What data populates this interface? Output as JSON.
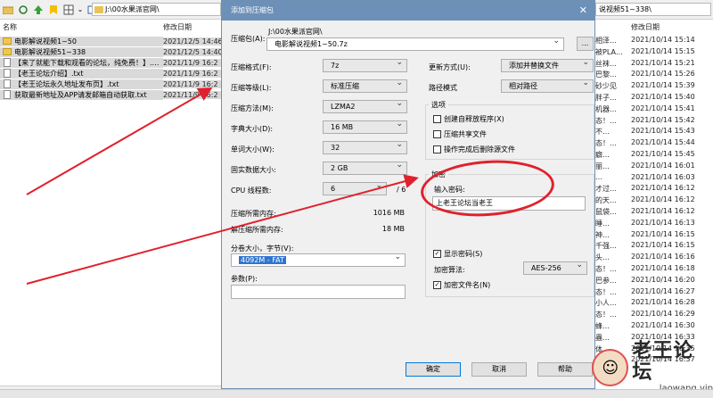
{
  "explorer_left": {
    "path": "J:\\00水果派官网\\",
    "columns": [
      "名称",
      "修改日期"
    ],
    "rows": [
      {
        "icon": "folder-icon",
        "name": "电影解说视频1~50",
        "date": "2021/12/5 14:46",
        "selected": true
      },
      {
        "icon": "folder-icon",
        "name": "电影解说视频51~338",
        "date": "2021/12/5 14:40",
        "selected": true
      },
      {
        "icon": "text-file-icon",
        "name": "【来了就能下载和观看的论坛，纯免费！】.…",
        "date": "2021/11/9 16:2",
        "selected": true
      },
      {
        "icon": "text-file-icon",
        "name": "【老王论坛介绍】.txt",
        "date": "2021/11/9 16:2",
        "selected": true
      },
      {
        "icon": "text-file-icon",
        "name": "【老王论坛永久地址发布页】.txt",
        "date": "2021/11/9 16:2",
        "selected": true
      },
      {
        "icon": "text-file-icon",
        "name": "获取最新地址及APP请发邮箱自动获取.txt",
        "date": "2021/11/9 16:2",
        "selected": true
      }
    ]
  },
  "explorer_right": {
    "path": "说视频51~338\\",
    "date_header": "修改日期",
    "rows": [
      {
        "name": "相泽…",
        "date": "2021/10/14 15:14"
      },
      {
        "name": "被PLA…",
        "date": "2021/10/14 15:15"
      },
      {
        "name": "丝袜…",
        "date": "2021/10/14 15:21"
      },
      {
        "name": "巴黎…",
        "date": "2021/10/14 15:26"
      },
      {
        "name": "砂少见",
        "date": "2021/10/14 15:39"
      },
      {
        "name": "胖子…",
        "date": "2021/10/14 15:40"
      },
      {
        "name": "机器…",
        "date": "2021/10/14 15:41"
      },
      {
        "name": "态！…",
        "date": "2021/10/14 15:42"
      },
      {
        "name": "不…",
        "date": "2021/10/14 15:43"
      },
      {
        "name": "态！…",
        "date": "2021/10/14 15:44"
      },
      {
        "name": "癖…",
        "date": "2021/10/14 15:45"
      },
      {
        "name": "丽…",
        "date": "2021/10/14 16:01"
      },
      {
        "name": "…",
        "date": "2021/10/14 16:03"
      },
      {
        "name": "才过…",
        "date": "2021/10/14 16:12"
      },
      {
        "name": "的天…",
        "date": "2021/10/14 16:12"
      },
      {
        "name": "鼠袋…",
        "date": "2021/10/14 16:12"
      },
      {
        "name": "睡…",
        "date": "2021/10/14 16:13"
      },
      {
        "name": "神…",
        "date": "2021/10/14 16:15"
      },
      {
        "name": "千强…",
        "date": "2021/10/14 16:15"
      },
      {
        "name": "头…",
        "date": "2021/10/14 16:16"
      },
      {
        "name": "态！…",
        "date": "2021/10/14 16:18"
      },
      {
        "name": "巴参…",
        "date": "2021/10/14 16:20"
      },
      {
        "name": "态！…",
        "date": "2021/10/14 16:27"
      },
      {
        "name": "小人…",
        "date": "2021/10/14 16:28"
      },
      {
        "name": "态！…",
        "date": "2021/10/14 16:29"
      },
      {
        "name": "蜂…",
        "date": "2021/10/14 16:30"
      },
      {
        "name": "蟲…",
        "date": "2021/10/14 16:33"
      },
      {
        "name": "体…",
        "date": "2021/10/14 16:35"
      },
      {
        "name": "…",
        "date": "2021/10/14 16:37"
      }
    ]
  },
  "dialog": {
    "title": "添加到压缩包",
    "close_glyph": "✕",
    "archive_label": "压缩包(A):",
    "archive_dir": "J:\\00水果派官网\\",
    "archive_name": "电影解说视频1~50.7z",
    "browse_label": "...",
    "format_label": "压缩格式(F):",
    "format_value": "7z",
    "level_label": "压缩等级(L):",
    "level_value": "标准压缩",
    "method_label": "压缩方法(M):",
    "method_value": "LZMA2",
    "dict_label": "字典大小(D):",
    "dict_value": "16 MB",
    "word_label": "单词大小(W):",
    "word_value": "32",
    "solid_label": "固实数据大小:",
    "solid_value": "2 GB",
    "threads_label": "CPU 线程数:",
    "threads_value": "6",
    "threads_total": "/ 6",
    "mem_compress_label": "压缩所需内存:",
    "mem_compress_value": "1016 MB",
    "mem_decompress_label": "解压缩所需内存:",
    "mem_decompress_value": "18 MB",
    "split_label": "分卷大小，字节(V):",
    "split_value": "4092M - FAT",
    "params_label": "参数(P):",
    "params_value": "",
    "update_label": "更新方式(U):",
    "update_value": "添加并替换文件",
    "pathmode_label": "路径模式",
    "pathmode_value": "相对路径",
    "options_title": "选项",
    "opt_sfx": "创建自释放程序(X)",
    "opt_shared": "压缩共享文件",
    "opt_delete": "操作完成后删除源文件",
    "encrypt_title": "加密",
    "password_label": "输入密码:",
    "password_value": "上老王论坛当老王",
    "show_password": "显示密码(S)",
    "encrypt_method_label": "加密算法:",
    "encrypt_method_value": "AES-256",
    "encrypt_names": "加密文件名(N)",
    "ok_label": "确定",
    "cancel_label": "取消",
    "help_label": "帮助"
  },
  "watermark": {
    "main": "老王论坛",
    "sub": "laowang.vip"
  },
  "annotation_color": "#e0212d"
}
